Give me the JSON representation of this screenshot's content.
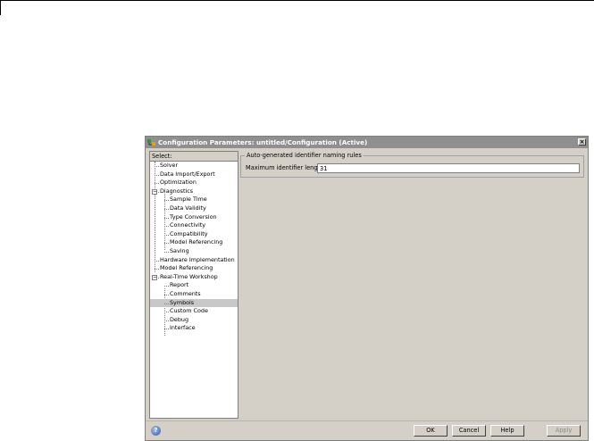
{
  "window": {
    "title": "Configuration Parameters: untitled/Configuration (Active)",
    "close_glyph": "×"
  },
  "tree": {
    "header": "Select:",
    "items": [
      {
        "label": "Solver",
        "level": 0,
        "expander": ""
      },
      {
        "label": "Data Import/Export",
        "level": 0,
        "expander": ""
      },
      {
        "label": "Optimization",
        "level": 0,
        "expander": ""
      },
      {
        "label": "Diagnostics",
        "level": 0,
        "expander": "−"
      },
      {
        "label": "Sample Time",
        "level": 1,
        "expander": ""
      },
      {
        "label": "Data Validity",
        "level": 1,
        "expander": ""
      },
      {
        "label": "Type Conversion",
        "level": 1,
        "expander": ""
      },
      {
        "label": "Connectivity",
        "level": 1,
        "expander": ""
      },
      {
        "label": "Compatibility",
        "level": 1,
        "expander": ""
      },
      {
        "label": "Model Referencing",
        "level": 1,
        "expander": ""
      },
      {
        "label": "Saving",
        "level": 1,
        "expander": ""
      },
      {
        "label": "Hardware Implementation",
        "level": 0,
        "expander": ""
      },
      {
        "label": "Model Referencing",
        "level": 0,
        "expander": ""
      },
      {
        "label": "Real-Time Workshop",
        "level": 0,
        "expander": "−"
      },
      {
        "label": "Report",
        "level": 1,
        "expander": ""
      },
      {
        "label": "Comments",
        "level": 1,
        "expander": ""
      },
      {
        "label": "Symbols",
        "level": 1,
        "expander": "",
        "selected": true
      },
      {
        "label": "Custom Code",
        "level": 1,
        "expander": ""
      },
      {
        "label": "Debug",
        "level": 1,
        "expander": ""
      },
      {
        "label": "Interface",
        "level": 1,
        "expander": ""
      }
    ]
  },
  "pane": {
    "group_title": "Auto-generated identifier naming rules",
    "max_id_label": "Maximum identifier length:",
    "max_id_value": "31"
  },
  "footer": {
    "help_icon": "help-icon",
    "help_glyph": "?",
    "ok": "OK",
    "cancel": "Cancel",
    "help": "Help",
    "apply": "Apply"
  },
  "colors": {
    "dialog_bg": "#d4d0c8",
    "titlebar": "#8f8f8f",
    "selection": "#c8c8c8"
  }
}
